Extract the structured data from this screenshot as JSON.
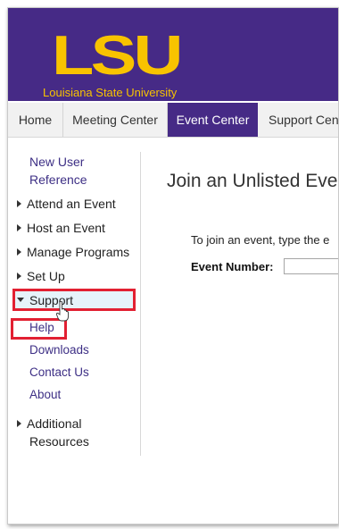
{
  "header": {
    "logo_text": "LSU",
    "tagline": "Louisiana State University",
    "logo_color": "#f8c300",
    "bg_color": "#462a86"
  },
  "nav": {
    "tabs": [
      {
        "label": "Home"
      },
      {
        "label": "Meeting Center"
      },
      {
        "label": "Event Center",
        "active": true
      },
      {
        "label": "Support Cent"
      }
    ]
  },
  "sidebar": {
    "new_user_line1": "New User",
    "new_user_line2": "Reference",
    "attend": "Attend an Event",
    "host": "Host an Event",
    "manage": "Manage Programs",
    "setup": "Set Up",
    "support": "Support",
    "support_children": {
      "help": "Help",
      "downloads": "Downloads",
      "contact": "Contact Us",
      "about": "About"
    },
    "additional_line1": "Additional",
    "additional_line2": "Resources"
  },
  "main": {
    "title": "Join an Unlisted Eve",
    "instruction": "To join an event, type the e",
    "event_number_label": "Event Number:",
    "event_number_value": ""
  },
  "highlight_color": "#e22032"
}
